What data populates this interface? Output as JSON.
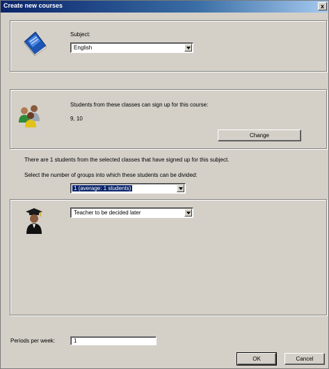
{
  "window": {
    "title": "Create new courses",
    "close_label": "x"
  },
  "subject": {
    "label": "Subject:",
    "value": "English"
  },
  "classes": {
    "description": "Students from these classes can sign up for this course:",
    "value": "9, 10",
    "change_label": "Change"
  },
  "signup_info": "There are 1 students from the selected classes that have signed up for this subject.",
  "groups": {
    "label": "Select the number of groups into which these students can be divided:",
    "value": "1 (average: 1 students)"
  },
  "teacher": {
    "value": "Teacher to be decided later"
  },
  "periods": {
    "label": "Periods per week:",
    "value": "1"
  },
  "buttons": {
    "ok": "OK",
    "cancel": "Cancel"
  },
  "icons": {
    "subject": "book-icon",
    "classes": "students-group-icon",
    "teacher": "graduate-teacher-icon"
  }
}
